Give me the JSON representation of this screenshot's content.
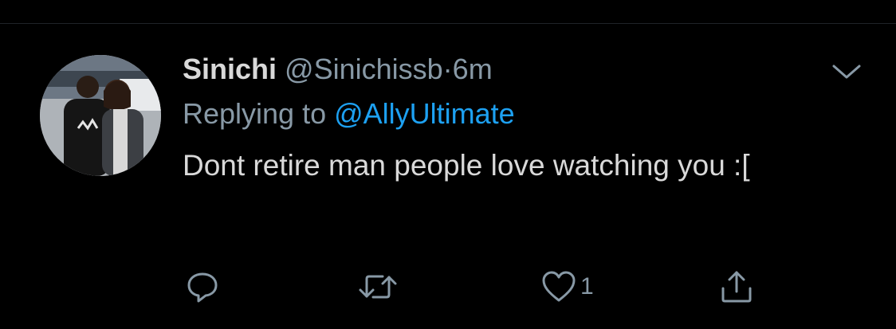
{
  "tweet": {
    "display_name": "Sinichi",
    "handle": "@Sinichissb",
    "separator": "·",
    "time": "6m",
    "replying_prefix": "Replying to",
    "replying_to": "@AllyUltimate",
    "text": "Dont retire man people love watching you :[",
    "like_count": "1"
  },
  "icons": {
    "more": "chevron-down-icon",
    "reply": "reply-bubble-icon",
    "retweet": "retweet-icon",
    "like": "heart-icon",
    "share": "share-icon"
  },
  "colors": {
    "background": "#000000",
    "text": "#d9d9d9",
    "secondary": "#8899a6",
    "link": "#1da1f2"
  }
}
